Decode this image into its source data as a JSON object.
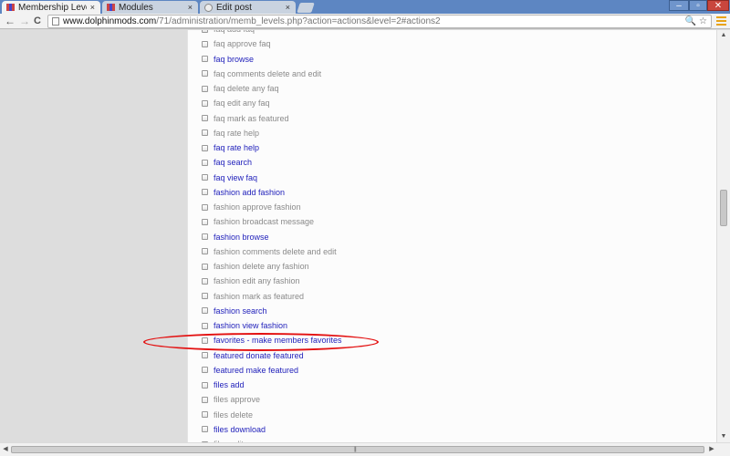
{
  "browser": {
    "tabs": [
      {
        "label": "Membership Levels",
        "close": "×",
        "active": true
      },
      {
        "label": "Modules",
        "close": "×",
        "active": false
      },
      {
        "label": "Edit post",
        "close": "×",
        "active": false
      }
    ],
    "window_controls": {
      "minimize": "–",
      "maximize": "▫",
      "close": "✕"
    },
    "nav": {
      "back": "←",
      "forward": "→",
      "reload": "C"
    },
    "address": {
      "host": "www.dolphinmods.com",
      "path": "/71/administration/memb_levels.php?action=actions&level=2#actions2"
    },
    "omni_tools": "🔍 ☆"
  },
  "permissions": [
    {
      "label": "faq add faq",
      "enabled": false
    },
    {
      "label": "faq approve faq",
      "enabled": false
    },
    {
      "label": "faq browse",
      "enabled": true
    },
    {
      "label": "faq comments delete and edit",
      "enabled": false
    },
    {
      "label": "faq delete any faq",
      "enabled": false
    },
    {
      "label": "faq edit any faq",
      "enabled": false
    },
    {
      "label": "faq mark as featured",
      "enabled": false
    },
    {
      "label": "faq rate help",
      "enabled": false
    },
    {
      "label": "faq rate help",
      "enabled": true
    },
    {
      "label": "faq search",
      "enabled": true
    },
    {
      "label": "faq view faq",
      "enabled": true
    },
    {
      "label": "fashion add fashion",
      "enabled": true
    },
    {
      "label": "fashion approve fashion",
      "enabled": false
    },
    {
      "label": "fashion broadcast message",
      "enabled": false
    },
    {
      "label": "fashion browse",
      "enabled": true
    },
    {
      "label": "fashion comments delete and edit",
      "enabled": false
    },
    {
      "label": "fashion delete any fashion",
      "enabled": false
    },
    {
      "label": "fashion edit any fashion",
      "enabled": false
    },
    {
      "label": "fashion mark as featured",
      "enabled": false
    },
    {
      "label": "fashion search",
      "enabled": true
    },
    {
      "label": "fashion view fashion",
      "enabled": true
    },
    {
      "label": "favorites - make members favorites",
      "enabled": true
    },
    {
      "label": "featured donate featured",
      "enabled": true
    },
    {
      "label": "featured make featured",
      "enabled": true
    },
    {
      "label": "files add",
      "enabled": true
    },
    {
      "label": "files approve",
      "enabled": false
    },
    {
      "label": "files delete",
      "enabled": false
    },
    {
      "label": "files download",
      "enabled": true
    },
    {
      "label": "files edit",
      "enabled": false
    }
  ],
  "colors": {
    "enabled_text": "#2222bb",
    "disabled_text": "#8a8a8a",
    "highlight": "#e31010"
  }
}
